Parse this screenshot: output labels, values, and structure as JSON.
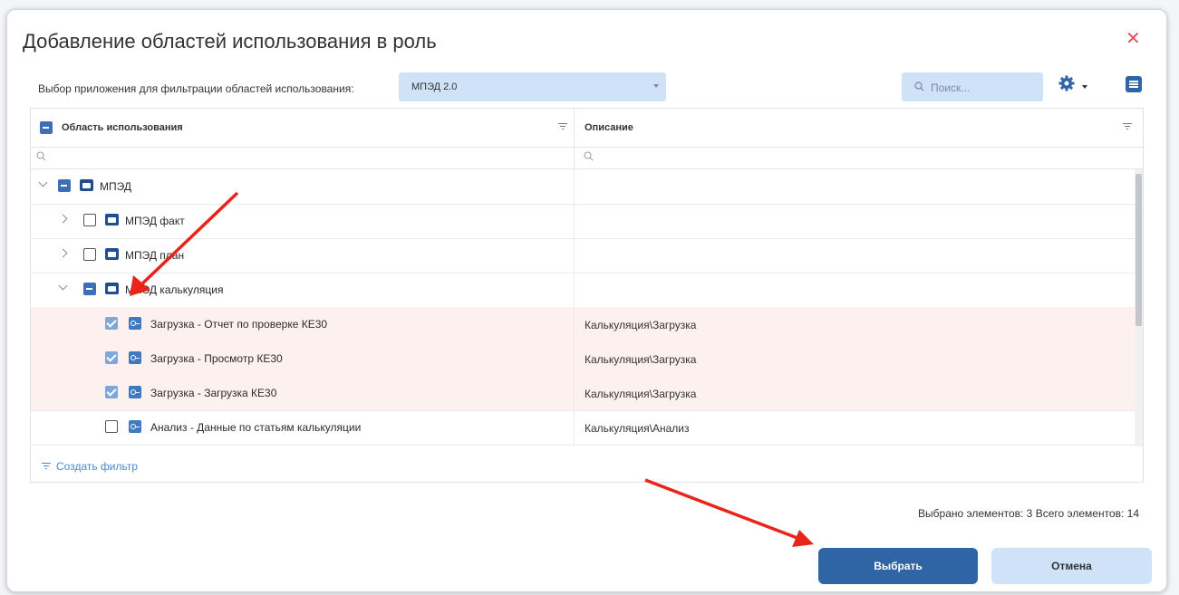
{
  "dialog": {
    "title": "Добавление областей использования в роль",
    "filter_label": "Выбор приложения для фильтрации областей использования:",
    "app_select_value": "МПЭД 2.0",
    "search_placeholder": "Поиск..."
  },
  "grid": {
    "columns": [
      {
        "label": "Область использования"
      },
      {
        "label": "Описание"
      }
    ],
    "rows": [
      {
        "label": "МПЭД",
        "description": "",
        "checked": "indeterminate",
        "expanded": true,
        "icon": "folder-icon",
        "level": 0
      },
      {
        "label": "МПЭД факт",
        "description": "",
        "checked": "unchecked",
        "expanded": false,
        "icon": "folder-icon",
        "level": 1
      },
      {
        "label": "МПЭД план",
        "description": "",
        "checked": "unchecked",
        "expanded": false,
        "icon": "folder-icon",
        "level": 1
      },
      {
        "label": "МПЭД калькуляция",
        "description": "",
        "checked": "indeterminate",
        "expanded": true,
        "icon": "folder-icon",
        "level": 1
      },
      {
        "label": "Загрузка - Отчет по проверке КЕ30",
        "description": "Калькуляция\\Загрузка",
        "checked": "checked",
        "icon": "key-icon",
        "level": 2
      },
      {
        "label": "Загрузка - Просмотр КЕ30",
        "description": "Калькуляция\\Загрузка",
        "checked": "checked",
        "icon": "key-icon",
        "level": 2
      },
      {
        "label": "Загрузка - Загрузка КЕ30",
        "description": "Калькуляция\\Загрузка",
        "checked": "checked",
        "icon": "key-icon",
        "level": 2
      },
      {
        "label": "Анализ - Данные по статьям калькуляции",
        "description": "Калькуляция\\Анализ",
        "checked": "unchecked",
        "icon": "key-icon",
        "level": 2
      }
    ],
    "create_filter_label": "Создать фильтр"
  },
  "status": {
    "selected_text": "Выбрано элементов: 3",
    "total_text": "Всего элементов: 14"
  },
  "buttons": {
    "select_label": "Выбрать",
    "cancel_label": "Отмена"
  },
  "colors": {
    "accent": "#2f64a5",
    "light_accent": "#cfe2f8",
    "selected_row": "#fdf1f0",
    "annotation_arrow": "#e8241b",
    "close": "#e0525b"
  }
}
